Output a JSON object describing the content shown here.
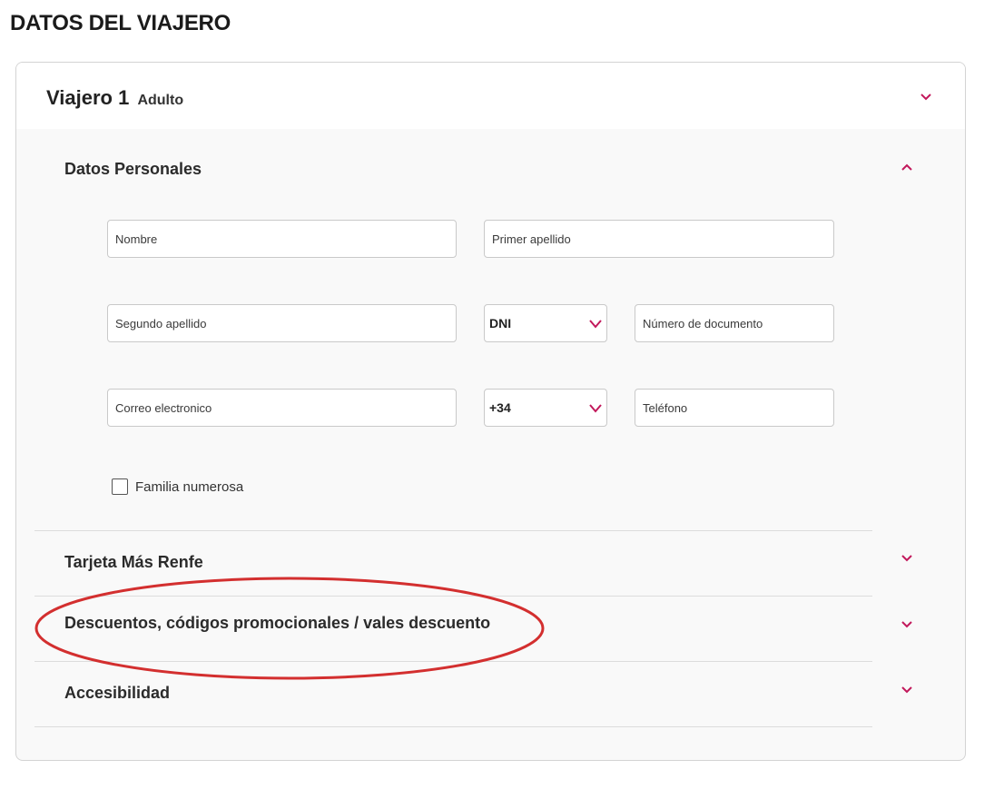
{
  "page": {
    "title": "DATOS DEL VIAJERO"
  },
  "traveler": {
    "title": "Viajero 1",
    "type": "Adulto"
  },
  "personal": {
    "title": "Datos Personales",
    "fields": {
      "nombre": "Nombre",
      "primer_apellido": "Primer apellido",
      "segundo_apellido": "Segundo apellido",
      "doc_type": "DNI",
      "doc_number": "Número de documento",
      "email": "Correo electronico",
      "phone_prefix": "+34",
      "phone": "Teléfono"
    },
    "checkbox_label": "Familia numerosa",
    "checkbox_checked": false
  },
  "sections": {
    "tarjeta": "Tarjeta Más Renfe",
    "descuentos": "Descuentos, códigos promocionales / vales descuento",
    "accesibilidad": "Accesibilidad"
  },
  "colors": {
    "accent": "#c2185b",
    "annotation": "#d32f2f",
    "border": "#c9c9c9",
    "card_bg": "#f9f9f9"
  },
  "icons": {
    "collapsed": "chevron-down-icon",
    "expanded": "chevron-up-icon"
  }
}
